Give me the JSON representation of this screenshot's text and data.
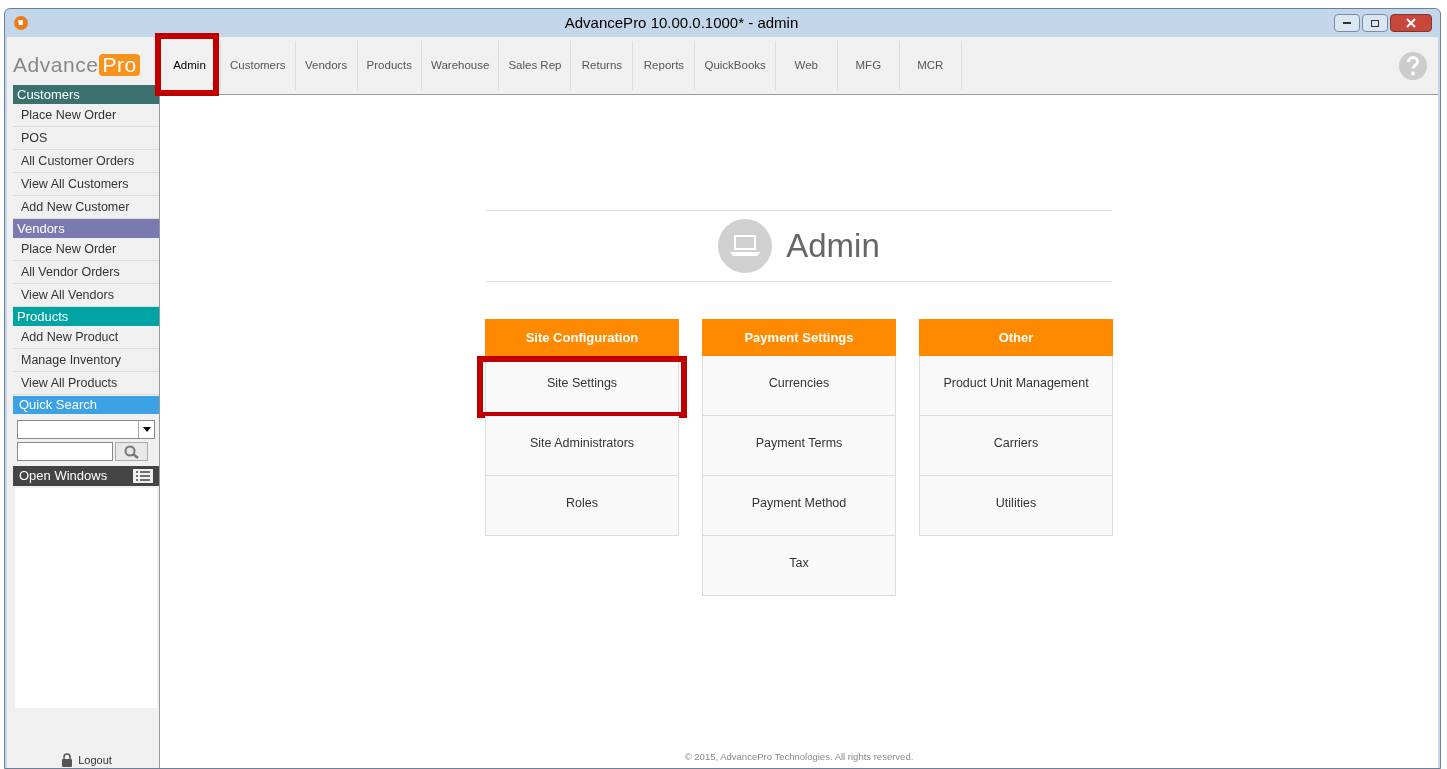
{
  "window": {
    "title": "AdvancePro 10.00.0.1000*  - admin"
  },
  "logo": {
    "text": "Advance",
    "badge": "Pro"
  },
  "tabs": [
    {
      "label": "Admin",
      "selected": true,
      "highlighted": true
    },
    {
      "label": "Customers",
      "selected": false,
      "highlighted": false
    },
    {
      "label": "Vendors",
      "selected": false,
      "highlighted": false
    },
    {
      "label": "Products",
      "selected": false,
      "highlighted": false
    },
    {
      "label": "Warehouse",
      "selected": false,
      "highlighted": false
    },
    {
      "label": "Sales Rep",
      "selected": false,
      "highlighted": false
    },
    {
      "label": "Returns",
      "selected": false,
      "highlighted": false
    },
    {
      "label": "Reports",
      "selected": false,
      "highlighted": false
    },
    {
      "label": "QuickBooks",
      "selected": false,
      "highlighted": false
    },
    {
      "label": "Web",
      "selected": false,
      "highlighted": false
    },
    {
      "label": "MFG",
      "selected": false,
      "highlighted": false
    },
    {
      "label": "MCR",
      "selected": false,
      "highlighted": false
    }
  ],
  "sidebar": {
    "sections": [
      {
        "title": "Customers",
        "color": "#3a716f",
        "items": [
          "Place New Order",
          "POS",
          "All Customer Orders",
          "View All Customers",
          "Add New Customer"
        ]
      },
      {
        "title": "Vendors",
        "color": "#7a79b0",
        "items": [
          "Place New Order",
          "All Vendor Orders",
          "View All Vendors"
        ]
      },
      {
        "title": "Products",
        "color": "#00a4a3",
        "items": [
          "Add New Product",
          "Manage Inventory",
          "View All Products"
        ]
      }
    ],
    "quick_search": {
      "title": "Quick Search"
    },
    "open_windows": {
      "title": "Open Windows"
    },
    "logout": "Logout"
  },
  "page": {
    "title": "Admin",
    "groups": [
      {
        "title": "Site Configuration",
        "items": [
          {
            "label": "Site Settings",
            "highlighted": true
          },
          {
            "label": "Site Administrators",
            "highlighted": false
          },
          {
            "label": "Roles",
            "highlighted": false
          }
        ]
      },
      {
        "title": "Payment Settings",
        "items": [
          {
            "label": "Currencies",
            "highlighted": false
          },
          {
            "label": "Payment Terms",
            "highlighted": false
          },
          {
            "label": "Payment Method",
            "highlighted": false
          },
          {
            "label": "Tax",
            "highlighted": false
          }
        ]
      },
      {
        "title": "Other",
        "items": [
          {
            "label": "Product Unit Management",
            "highlighted": false
          },
          {
            "label": "Carriers",
            "highlighted": false
          },
          {
            "label": "Utilities",
            "highlighted": false
          }
        ]
      }
    ],
    "footer": "© 2015, AdvancePro Technologies. All rights reserved."
  }
}
